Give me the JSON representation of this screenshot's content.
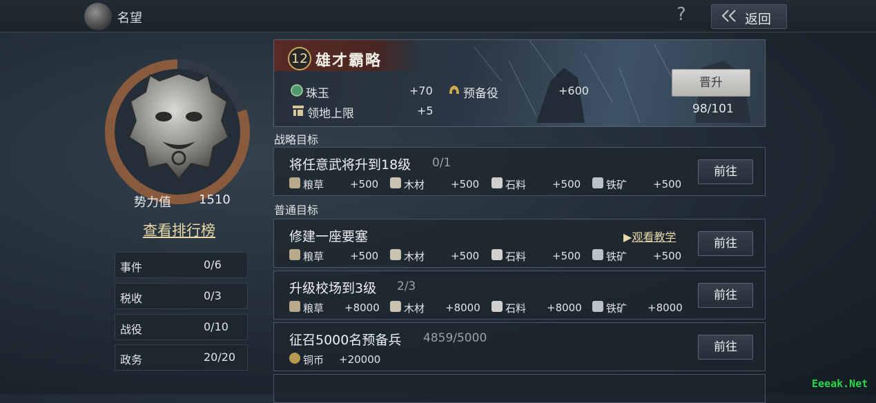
{
  "header": {
    "title": "名望",
    "help_icon": "?",
    "back_label": "返回"
  },
  "profile": {
    "power_label": "势力值",
    "power_value": "1510",
    "ranking_link": "查看排行榜",
    "progress_ring_fraction": 0.8,
    "stats": [
      {
        "name": "事件",
        "value": "0/6"
      },
      {
        "name": "税收",
        "value": "0/3"
      },
      {
        "name": "战役",
        "value": "0/10"
      },
      {
        "name": "政务",
        "value": "20/20"
      }
    ]
  },
  "banner": {
    "level": "12",
    "title": "雄才霸略",
    "rewards": [
      {
        "icon": "jade-icon",
        "name": "珠玉",
        "amount": "+70"
      },
      {
        "icon": "helmet-icon",
        "name": "预备役",
        "amount": "+600"
      },
      {
        "icon": "territory-icon",
        "name": "领地上限",
        "amount": "+5"
      }
    ],
    "promote_label": "晋升",
    "promote_progress": "98/101"
  },
  "strategic": {
    "label": "战略目标",
    "tasks": [
      {
        "title": "将任意武将升到18级",
        "progress": "0/1",
        "go_label": "前往",
        "resources": [
          {
            "icon": "grain-icon",
            "name": "粮草",
            "amount": "+500"
          },
          {
            "icon": "wood-icon",
            "name": "木材",
            "amount": "+500"
          },
          {
            "icon": "stone-icon",
            "name": "石料",
            "amount": "+500"
          },
          {
            "icon": "iron-icon",
            "name": "铁矿",
            "amount": "+500"
          }
        ]
      }
    ]
  },
  "normal": {
    "label": "普通目标",
    "tasks": [
      {
        "title": "修建一座要塞",
        "tutorial_label": "观看教学",
        "go_label": "前往",
        "resources": [
          {
            "icon": "grain-icon",
            "name": "粮草",
            "amount": "+500"
          },
          {
            "icon": "wood-icon",
            "name": "木材",
            "amount": "+500"
          },
          {
            "icon": "stone-icon",
            "name": "石料",
            "amount": "+500"
          },
          {
            "icon": "iron-icon",
            "name": "铁矿",
            "amount": "+500"
          }
        ]
      },
      {
        "title": "升级校场到3级",
        "progress": "2/3",
        "go_label": "前往",
        "resources": [
          {
            "icon": "grain-icon",
            "name": "粮草",
            "amount": "+8000"
          },
          {
            "icon": "wood-icon",
            "name": "木材",
            "amount": "+8000"
          },
          {
            "icon": "stone-icon",
            "name": "石料",
            "amount": "+8000"
          },
          {
            "icon": "iron-icon",
            "name": "铁矿",
            "amount": "+8000"
          }
        ]
      },
      {
        "title": "征召5000名预备兵",
        "progress": "4859/5000",
        "go_label": "前往",
        "resources": [
          {
            "icon": "coin-icon",
            "name": "铜币",
            "amount": "+20000"
          }
        ]
      }
    ]
  },
  "watermark": "Eeeak.Net",
  "colors": {
    "accent_gold": "#e9d9a8",
    "ring_copper": "#8a5a3c",
    "watermark_green": "#27d84a"
  }
}
